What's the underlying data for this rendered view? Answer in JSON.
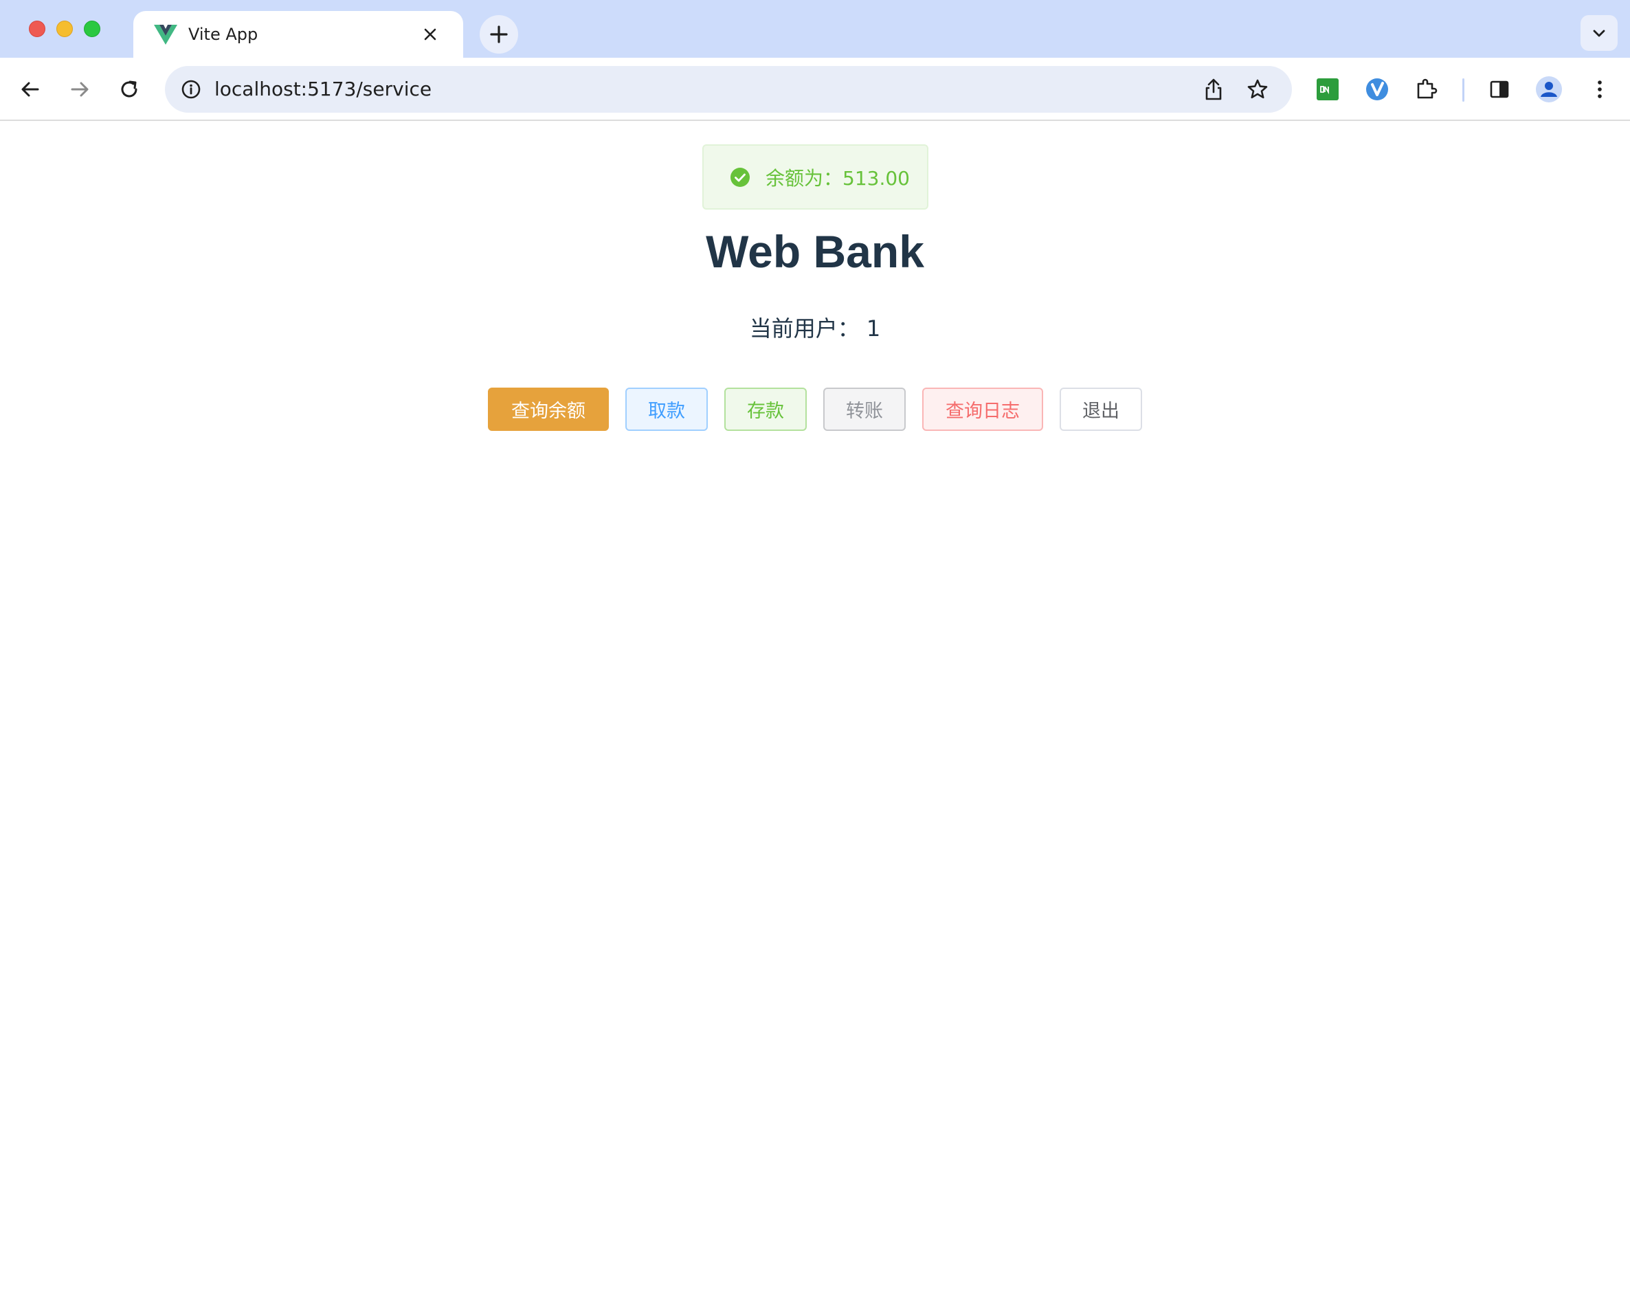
{
  "browser": {
    "tab": {
      "title": "Vite App",
      "favicon": "vue-logo-icon"
    },
    "address_bar": {
      "url": "localhost:5173/service"
    },
    "extensions": [
      "on-extension-icon",
      "vimium-icon",
      "puzzle-extensions-icon",
      "side-panel-icon",
      "profile-icon"
    ],
    "colors": {
      "tabbar": "#cddcfb",
      "omnibox": "#e8edf8"
    }
  },
  "page": {
    "message": {
      "text": "余额为：513.00",
      "type": "success",
      "color": "#67c23a"
    },
    "title": "Web Bank",
    "current_user": "当前用户： 1",
    "buttons": {
      "query_balance": "查询余额",
      "withdraw": "取款",
      "deposit": "存款",
      "transfer": "转账",
      "query_log": "查询日志",
      "logout": "退出"
    },
    "colors": {
      "warning": "#e6a23c",
      "primary": "#409eff",
      "success": "#67c23a",
      "info": "#909399",
      "danger": "#f56c6c",
      "text": "#213547"
    }
  }
}
